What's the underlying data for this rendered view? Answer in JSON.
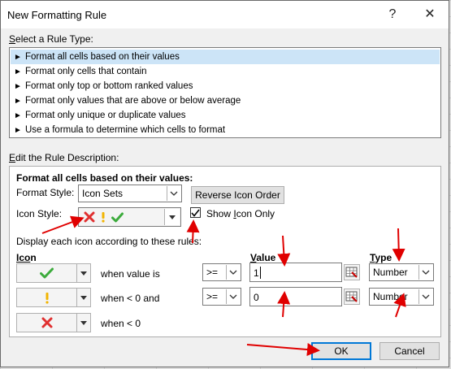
{
  "window": {
    "title": "New Formatting Rule",
    "help_glyph": "?",
    "close_glyph": "✕"
  },
  "rule_type": {
    "label": "Select a Rule Type:",
    "items": [
      "Format all cells based on their values",
      "Format only cells that contain",
      "Format only top or bottom ranked values",
      "Format only values that are above or below average",
      "Format only unique or duplicate values",
      "Use a formula to determine which cells to format"
    ],
    "selected_index": 0
  },
  "description": {
    "label": "Edit the Rule Description:",
    "heading": "Format all cells based on their values:",
    "format_style_label": "Format Style:",
    "format_style_value": "Icon Sets",
    "reverse_button": "Reverse Icon Order",
    "icon_style_label": "Icon Style:",
    "show_icon_only_label": "Show Icon Only",
    "show_icon_only_checked": true,
    "rules_caption": "Display each icon according to these rules:",
    "col_icon": "Icon",
    "col_value": "Value",
    "col_type": "Type",
    "rows": [
      {
        "icon": "green-check-icon",
        "condition": "when value is",
        "operator": ">=",
        "value": "1",
        "type": "Number"
      },
      {
        "icon": "yellow-exclamation-icon",
        "condition": "when < 0 and",
        "operator": ">=",
        "value": "0",
        "type": "Number"
      },
      {
        "icon": "red-x-icon",
        "condition": "when < 0"
      }
    ]
  },
  "buttons": {
    "ok": "OK",
    "cancel": "Cancel"
  },
  "colors": {
    "selection": "#cce4f7",
    "accent": "#0078d7",
    "annotation_arrow": "#e00000",
    "check_green": "#3cab3c",
    "exclaim_yellow": "#f2b400",
    "x_red": "#e03030"
  }
}
